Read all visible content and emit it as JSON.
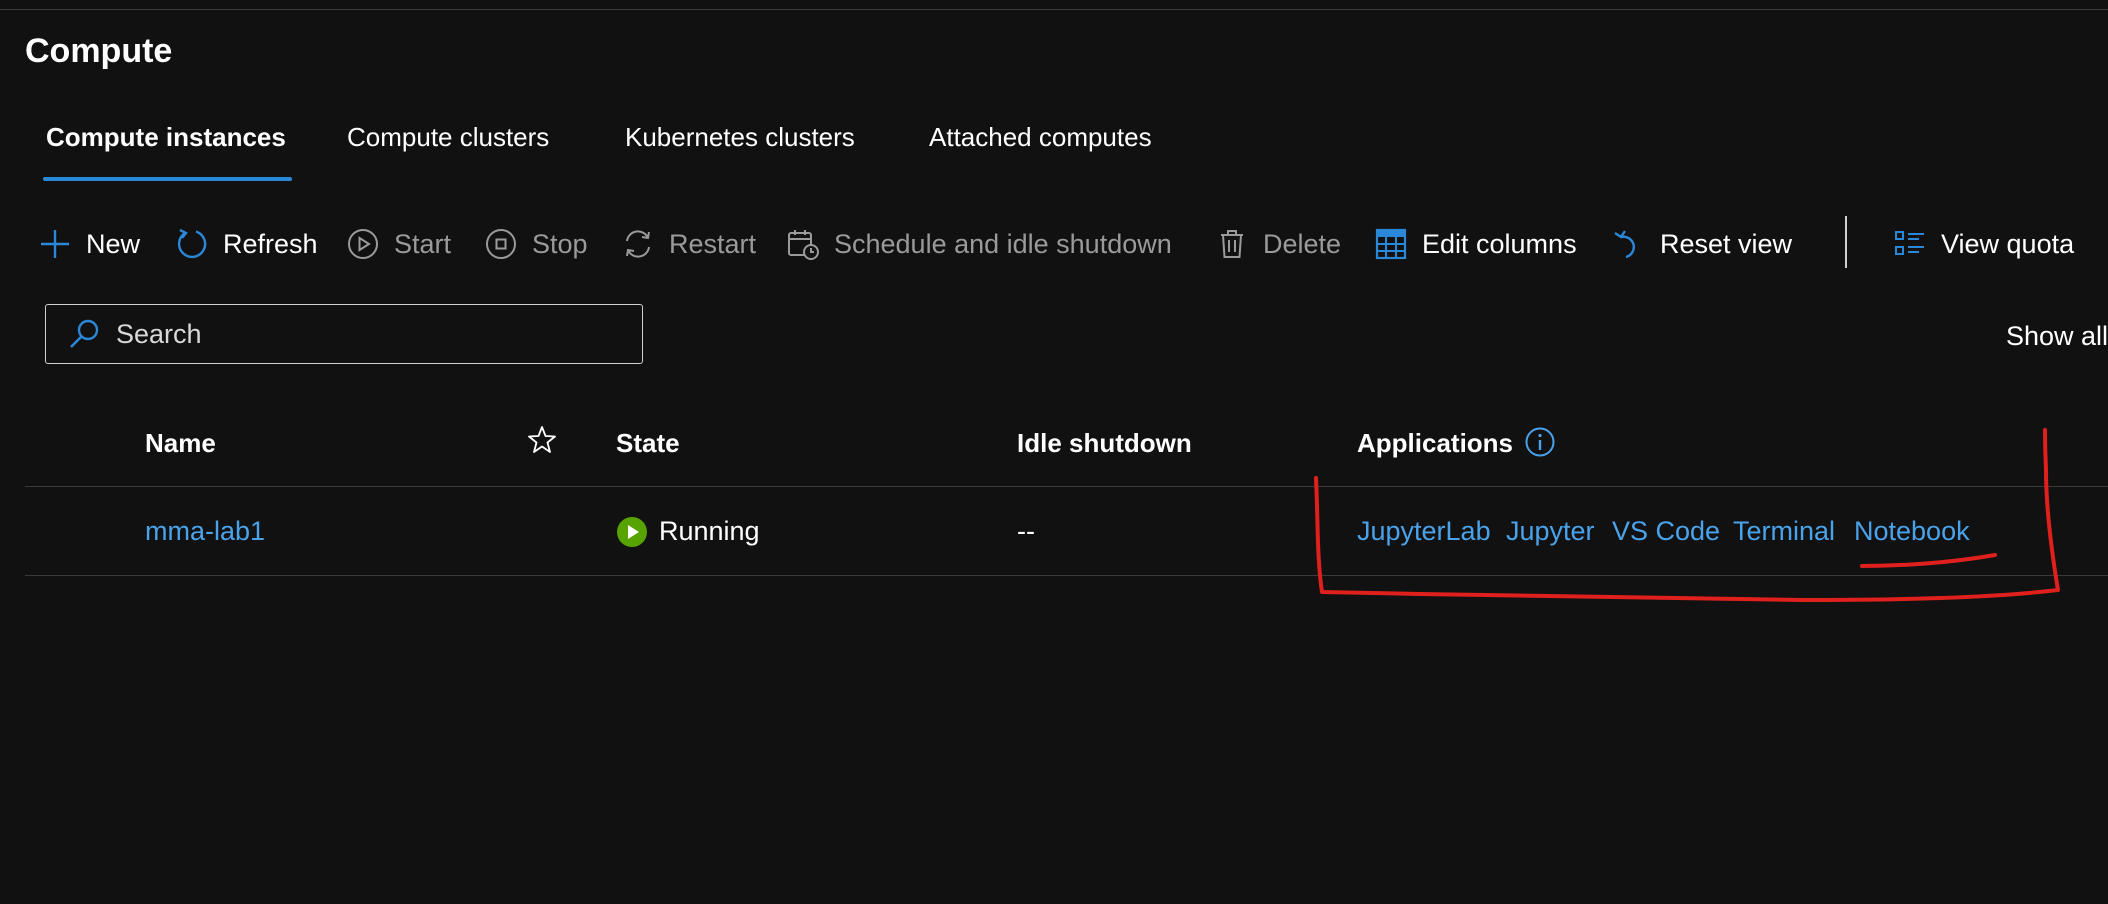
{
  "page": {
    "title": "Compute"
  },
  "tabs": [
    {
      "label": "Compute instances",
      "active": true
    },
    {
      "label": "Compute clusters",
      "active": false
    },
    {
      "label": "Kubernetes clusters",
      "active": false
    },
    {
      "label": "Attached computes",
      "active": false
    }
  ],
  "toolbar": {
    "new": {
      "label": "New",
      "icon": "plus-icon",
      "enabled": true
    },
    "refresh": {
      "label": "Refresh",
      "icon": "refresh-icon",
      "enabled": true
    },
    "start": {
      "label": "Start",
      "icon": "play-circle-icon",
      "enabled": false
    },
    "stop": {
      "label": "Stop",
      "icon": "stop-circle-icon",
      "enabled": false
    },
    "restart": {
      "label": "Restart",
      "icon": "restart-icon",
      "enabled": false
    },
    "schedule": {
      "label": "Schedule and idle shutdown",
      "icon": "calendar-clock-icon",
      "enabled": false
    },
    "delete": {
      "label": "Delete",
      "icon": "trash-icon",
      "enabled": false
    },
    "edit_columns": {
      "label": "Edit columns",
      "icon": "columns-icon",
      "enabled": true
    },
    "reset_view": {
      "label": "Reset view",
      "icon": "undo-icon",
      "enabled": true
    },
    "view_quota": {
      "label": "View quota",
      "icon": "list-icon",
      "enabled": true
    }
  },
  "search": {
    "placeholder": "Search",
    "value": ""
  },
  "filter": {
    "show_all_label": "Show all"
  },
  "table": {
    "columns": {
      "name": "Name",
      "state": "State",
      "idle_shutdown": "Idle shutdown",
      "applications": "Applications"
    },
    "rows": [
      {
        "name": "mma-lab1",
        "state": "Running",
        "idle_shutdown": "--",
        "applications": [
          "JupyterLab",
          "Jupyter",
          "VS Code",
          "Terminal",
          "Notebook"
        ]
      }
    ]
  },
  "colors": {
    "accent": "#2b88d8",
    "link": "#4aa3ea",
    "running": "#57a300",
    "annotation": "#e0201c",
    "background": "#111111"
  }
}
